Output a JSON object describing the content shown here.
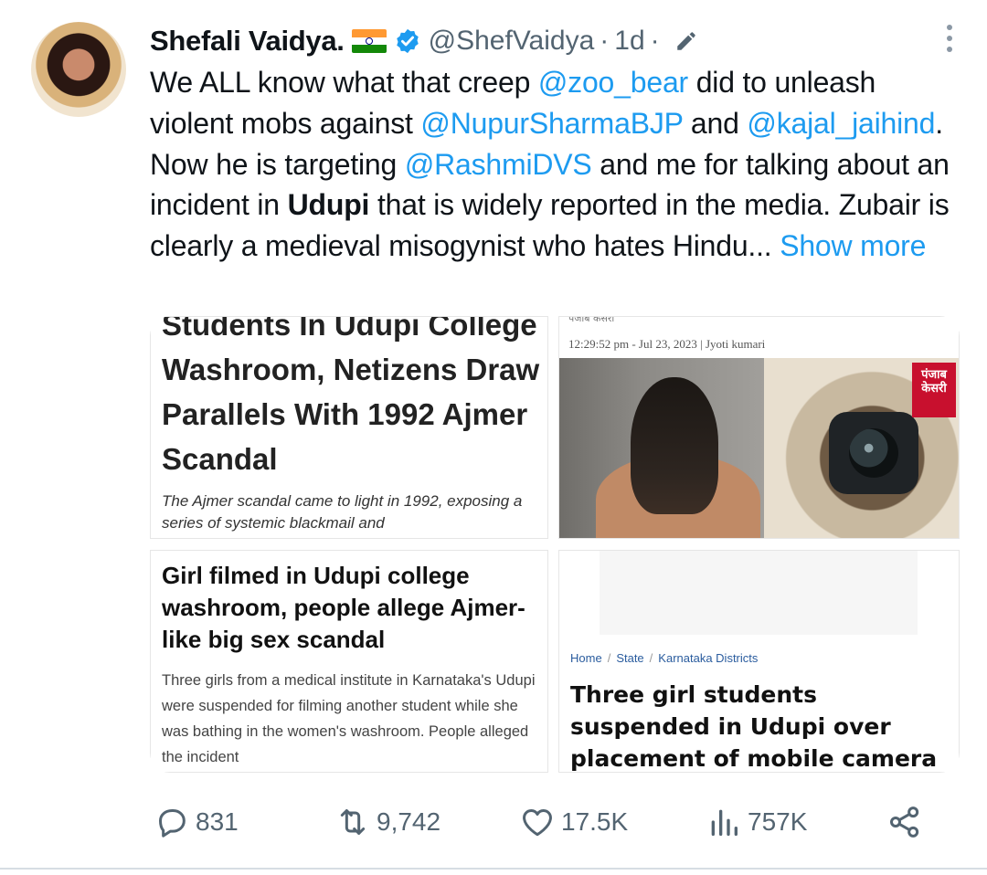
{
  "author": {
    "name": "Shefali Vaidya.",
    "handle": "@ShefVaidya",
    "separator": "·",
    "time": "1d"
  },
  "tweet": {
    "line1_a": "We ALL know what that creep ",
    "mention1": "@zoo_bear",
    "line1_b": " did to unleash violent mobs against ",
    "mention2": "@NupurSharmaBJP",
    "line1_c": " and ",
    "mention3": "@kajal_jaihind",
    "line2_a": ". Now he is targeting ",
    "mention4": "@RashmiDVS",
    "line2_b": " and me for talking about an incident in ",
    "bold_word": "Udupi",
    "line2_c": " that is widely reported in the media. Zubair is clearly a medieval misogynist who hates Hindu... ",
    "show_more": "Show more"
  },
  "media": {
    "tile1": {
      "headline": "Students In Udupi College Washroom, Netizens Draw Parallels With 1992 Ajmer Scandal",
      "summary": "The Ajmer scandal came to light in 1992, exposing a series of systemic blackmail and"
    },
    "tile2": {
      "meta_top": "पंजाब केसरी",
      "meta": "12:29:52 pm - Jul 23, 2023 | Jyoti kumari",
      "logo_text": "पंजाब केसरी"
    },
    "tile3": {
      "headline": "Girl filmed in Udupi college washroom, people allege Ajmer-like big sex scandal",
      "summary": "Three girls from a medical institute in Karnataka's Udupi were suspended for filming another student while she was bathing in the women's washroom. People alleged the incident"
    },
    "tile4": {
      "crumbs": [
        "Home",
        "State",
        "Karnataka Districts"
      ],
      "headline": "Three girl students suspended in Udupi over placement of mobile camera in bathroom"
    }
  },
  "actions": {
    "replies": "831",
    "retweets": "9,742",
    "likes": "17.5K",
    "views": "757K"
  },
  "icons": [
    "flag-india-icon",
    "verified-badge-icon",
    "edit-pen-icon",
    "more-options-icon",
    "reply-icon",
    "retweet-icon",
    "like-icon",
    "views-icon",
    "share-icon"
  ],
  "colors": {
    "link": "#1d9bf0",
    "muted": "#536471",
    "verified": "#1d9bf0"
  }
}
